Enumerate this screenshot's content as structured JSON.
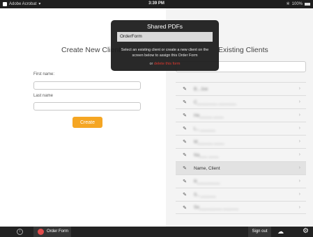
{
  "status_bar": {
    "app_label": "Adobe Acrobat",
    "time": "3:39 PM",
    "battery": "100%"
  },
  "left_pane": {
    "title": "Create New Client",
    "first_name_label": "First name:",
    "last_name_label": "Last name",
    "create_label": "Create"
  },
  "right_pane": {
    "title": "Existing Clients",
    "clients": [
      {
        "name": "B., Joe",
        "blurred": true
      },
      {
        "name": "C________ _______",
        "blurred": true
      },
      {
        "name": "He_____ ____",
        "blurred": true
      },
      {
        "name": "L., ______",
        "blurred": true
      },
      {
        "name": "M______ ____",
        "blurred": true
      },
      {
        "name": "Na___ ____",
        "blurred": true
      },
      {
        "name": "Name, Client",
        "blurred": false,
        "selected": true
      },
      {
        "name": "R_________",
        "blurred": true
      },
      {
        "name": "S., ______",
        "blurred": true
      },
      {
        "name": "Se_________ ______",
        "blurred": true
      }
    ]
  },
  "popover": {
    "title": "Shared PDFs",
    "selected_pdf": "OrderForm",
    "instructions": "Select an existing client or create a new client on the screen below to assign this Order Form",
    "or_label": "or",
    "delete_label": "delete this form"
  },
  "bottom_bar": {
    "info_glyph": "i",
    "tab_label": "Order Form",
    "sign_out_label": "Sign out"
  },
  "colors": {
    "accent_orange": "#f5a623",
    "delete_red": "#e0392f",
    "tab_dot_red": "#e34d4d"
  }
}
